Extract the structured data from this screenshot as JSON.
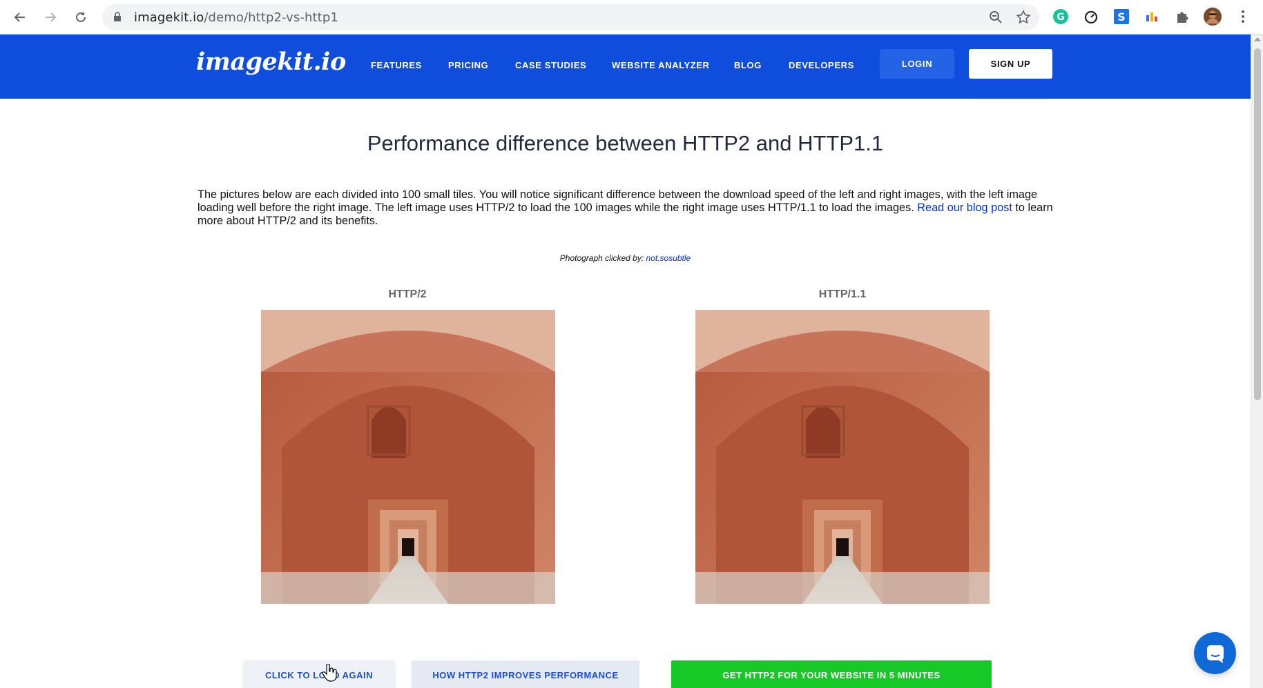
{
  "browser": {
    "url_host": "imagekit.io",
    "url_path": "/demo/http2-vs-http1",
    "icons": [
      "back-icon",
      "forward-icon",
      "reload-icon",
      "lock-icon",
      "zoom-icon",
      "star-icon",
      "grammarly-icon",
      "timer-icon",
      "s-extension-icon",
      "bars-extension-icon",
      "puzzle-icon",
      "profile-avatar",
      "kebab-menu-icon"
    ]
  },
  "header": {
    "logo": "imagekit.io",
    "menu": [
      "FEATURES",
      "PRICING",
      "CASE STUDIES",
      "WEBSITE ANALYZER",
      "BLOG",
      "DEVELOPERS"
    ],
    "login": "LOGIN",
    "signup": "SIGN UP"
  },
  "main": {
    "title": "Performance difference between HTTP2 and HTTP1.1",
    "intro_text": "The pictures below are each divided into 100 small tiles. You will notice significant difference between the download speed of the left and right images, with the left image loading well before the right image. The left image uses HTTP/2 to load the 100 images while the right image uses HTTP/1.1 to load the images. ",
    "intro_link": "Read our blog post",
    "intro_tail": " to learn more about HTTP/2 and its benefits.",
    "credit_prefix": "Photograph clicked by: ",
    "credit_link": "not.sosubtle",
    "left_label": "HTTP/2",
    "right_label": "HTTP/1.1",
    "btn_load": "CLICK TO LOAD AGAIN",
    "btn_how": "HOW HTTP2 IMPROVES PERFORMANCE",
    "btn_get": "GET HTTP2 FOR YOUR WEBSITE IN 5 MINUTES"
  },
  "colors": {
    "header_bg": "#0f4ddc",
    "cta_green": "#16c927",
    "link_blue": "#0033cc"
  }
}
